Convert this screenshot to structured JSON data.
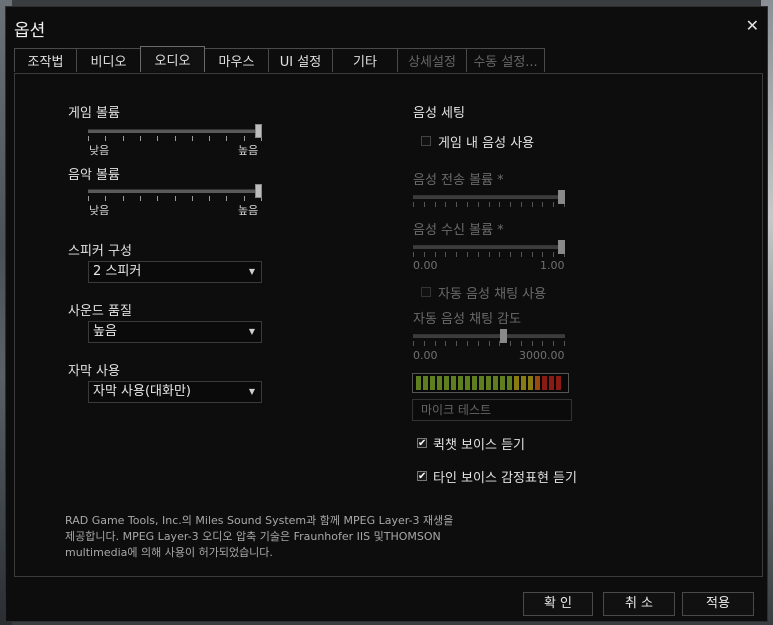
{
  "window": {
    "title": "옵션",
    "close_glyph": "✕"
  },
  "tabs": [
    {
      "label": "조작법",
      "state": "normal"
    },
    {
      "label": "비디오",
      "state": "normal"
    },
    {
      "label": "오디오",
      "state": "active"
    },
    {
      "label": "마우스",
      "state": "normal"
    },
    {
      "label": "UI 설정",
      "state": "normal"
    },
    {
      "label": "기타",
      "state": "normal"
    },
    {
      "label": "상세설정",
      "state": "disabled"
    },
    {
      "label": "수동 설정...",
      "state": "disabled"
    }
  ],
  "left": {
    "game_volume": {
      "label": "게임 볼륨",
      "min_label": "낮음",
      "max_label": "높음",
      "value_fraction": 1.0
    },
    "music_volume": {
      "label": "음악 볼륨",
      "min_label": "낮음",
      "max_label": "높음",
      "value_fraction": 1.0
    },
    "speaker": {
      "label": "스피커 구성",
      "value": "2 스피커"
    },
    "sound_quality": {
      "label": "사운드 품질",
      "value": "높음"
    },
    "subtitles": {
      "label": "자막 사용",
      "value": "자막 사용(대화만)"
    }
  },
  "right": {
    "voice_heading": "음성 세팅",
    "ingame_voice": {
      "label": "게임 내 음성 사용",
      "checked": false
    },
    "voice_send": {
      "label": "음성 전송 볼륨 *",
      "value_fraction": 1.0
    },
    "voice_recv": {
      "label": "음성 수신 볼륨 *",
      "min_label": "0.00",
      "max_label": "1.00",
      "value_fraction": 1.0
    },
    "auto_voice": {
      "label": "자동 음성 채팅 사용",
      "checked": false
    },
    "auto_sens": {
      "label": "자동 음성 채팅 감도",
      "min_label": "0.00",
      "max_label": "3000.00",
      "value_fraction": 0.6
    },
    "mic_test": "마이크 테스트",
    "quickchat_voice": {
      "label": "퀵챗 보이스 듣기",
      "checked": true
    },
    "other_emote_voice": {
      "label": "타인 보이스 감정표현 듣기",
      "checked": true
    },
    "check_glyph": "✔"
  },
  "legal": {
    "line1": "RAD Game Tools, Inc.의 Miles Sound System과 함께 MPEG Layer-3 재생을",
    "line2": "제공합니다. MPEG Layer-3 오디오 압축 기술은 Fraunhofer IIS 및THOMSON",
    "line3": "multimedia에 의해 사용이 허가되었습니다."
  },
  "buttons": {
    "ok": "확 인",
    "cancel": "취 소",
    "apply": "적용"
  },
  "colors": {
    "meter_green": "#5f7f1e",
    "meter_yellow": "#8a7a12",
    "meter_orange": "#9a4a10",
    "meter_red": "#8a1a14"
  }
}
